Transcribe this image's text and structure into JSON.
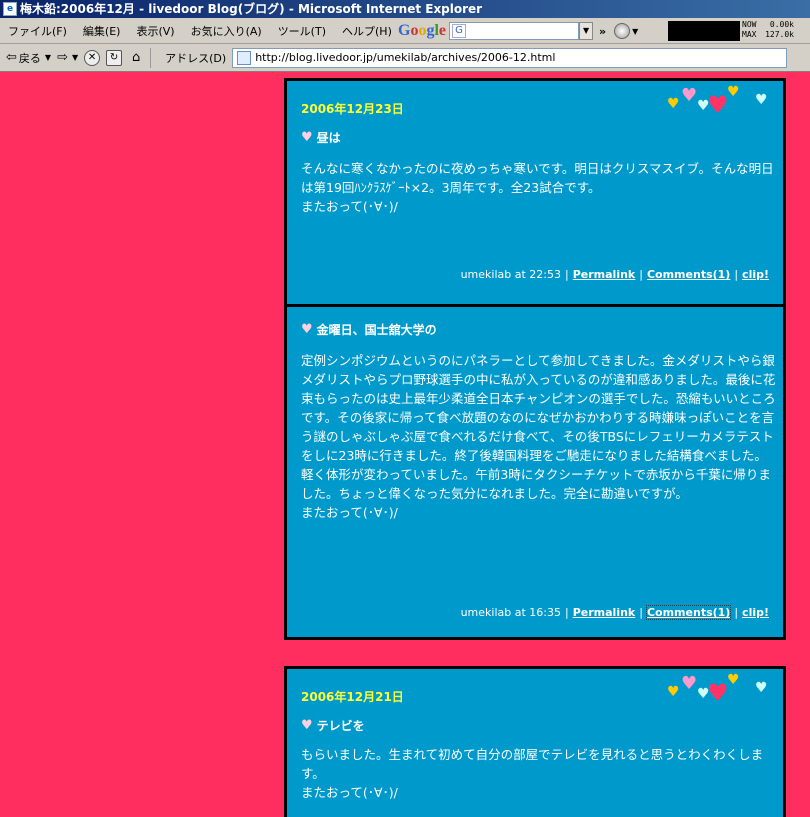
{
  "window": {
    "title": "梅木鉛:2006年12月 - livedoor Blog(ブログ) - Microsoft Internet Explorer"
  },
  "menu": [
    "ファイル(F)",
    "編集(E)",
    "表示(V)",
    "お気に入り(A)",
    "ツール(T)",
    "ヘルプ(H)"
  ],
  "google": {
    "logo": "Google",
    "input_letter": "G"
  },
  "netstat": {
    "now_label": "NOW",
    "now_value": "0.00k",
    "max_label": "MAX",
    "max_value": "127.0k"
  },
  "toolbar": {
    "back_label": "戻る",
    "address_label": "アドレス(D)",
    "url": "http://blog.livedoor.jp/umekilab/archives/2006-12.html"
  },
  "posts": [
    {
      "date": "2006年12月23日",
      "title": "昼は",
      "body": [
        "そんなに寒くなかったのに夜めっちゃ寒いです。明日はクリスマスイブ。そんな明日は第19回ﾊﾝｸﾗｽｹﾞｰﾄ×2。3周年です。全23試合です。",
        "またおって(･∀･)/"
      ],
      "author_time": "umekilab at 22:53",
      "permalink": "Permalink",
      "comments": "Comments(1)",
      "clip": "clip!"
    },
    {
      "date": "",
      "title": "金曜日、国士舘大学の",
      "body": [
        "定例シンポジウムというのにパネラーとして参加してきました。金メダリストやら銀メダリストやらプロ野球選手の中に私が入っているのが違和感ありました。最後に花束もらったのは史上最年少柔道全日本チャンピオンの選手でした。恐縮もいいところです。その後家に帰って食べ放題のなのになぜかおかわりする時嫌味っぽいことを言う謎のしゃぶしゃぶ屋で食べれるだけ食べて、その後TBSにレフェリーカメラテストをしに23時に行きました。終了後韓国料理をご馳走になりました結構食べました。軽く体形が変わっていました。午前3時にタクシーチケットで赤坂から千葉に帰りました。ちょっと偉くなった気分になれました。完全に勘違いですが。",
        "またおって(･∀･)/"
      ],
      "author_time": "umekilab at 16:35",
      "permalink": "Permalink",
      "comments": "Comments(1)",
      "clip": "clip!"
    },
    {
      "date": "2006年12月21日",
      "title": "テレビを",
      "body": [
        "もらいました。生まれて初めて自分の部屋でテレビを見れると思うとわくわくします。",
        "またおって(･∀･)/"
      ]
    }
  ],
  "colors": {
    "page_bg": "#ff2e5f",
    "post_bg": "#0099cc",
    "date": "#ffff33"
  }
}
